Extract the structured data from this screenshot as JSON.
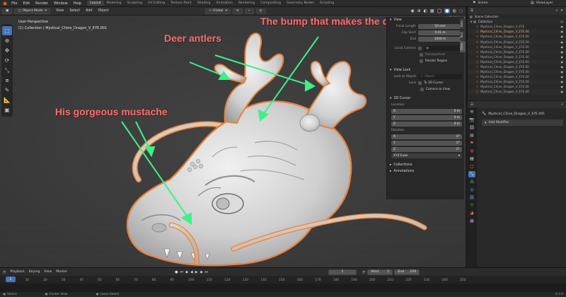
{
  "menu": [
    "File",
    "Edit",
    "Render",
    "Window",
    "Help"
  ],
  "workspaces": [
    "Layout",
    "Modeling",
    "Sculpting",
    "UV Editing",
    "Texture Paint",
    "Shading",
    "Animation",
    "Rendering",
    "Compositing",
    "Geometry Nodes",
    "Scripting"
  ],
  "scene_name": "Scene",
  "view_layer": "ViewLayer",
  "viewport_header": {
    "mode": "Object Mode",
    "menus": [
      "View",
      "Select",
      "Add",
      "Object"
    ],
    "orientation": "Global"
  },
  "viewport_info": {
    "line1": "User Perspective",
    "line2": "(1) Collection | Mystical_Chine_Dragon_V_EYE.001"
  },
  "options_label": "Options",
  "annotations": {
    "dragon_fly": "The bump that makes the dragon fly",
    "antlers": "Deer antlers",
    "mustache": "His gorgeous mustache",
    "color": "#ff6b6b",
    "arrow_color": "#3df08a"
  },
  "npanel": {
    "view_header": "View",
    "focal_length_label": "Focal Length",
    "focal_length": "50 mm",
    "clip_start_label": "Clip Start",
    "clip_start": "0.01 m",
    "clip_end_label": "End",
    "clip_end": "1000 m",
    "local_camera_label": "Local Camera",
    "passepartout_label": "Passepartout",
    "render_region_label": "Render Region",
    "view_lock_header": "View Lock",
    "lock_object_label": "Lock to Object",
    "lock_object_placeholder": "Object",
    "lock_label": "Lock",
    "to_3d_cursor": "To 3D Cursor",
    "camera_to_view": "Camera to View",
    "cursor_header": "3D Cursor",
    "location_label": "Location:",
    "loc_x_label": "X",
    "loc_x": "0 m",
    "loc_y_label": "Y",
    "loc_y": "0 m",
    "loc_z_label": "Z",
    "loc_z": "0 m",
    "rotation_label": "Rotation:",
    "rot_x_label": "X",
    "rot_x": "0°",
    "rot_y_label": "Y",
    "rot_y": "0°",
    "rot_z_label": "Z",
    "rot_z": "0°",
    "rotation_mode": "XYZ Euler",
    "collections_header": "Collections",
    "annotations_header": "Annotations",
    "tabs": [
      "Item",
      "Tool",
      "View"
    ]
  },
  "outliner": {
    "scene_collection": "Scene Collection",
    "collection": "Collection",
    "items": [
      "Mystical_Chine_Dragon_V_EYE",
      "Mystical_Chine_Dragon_V_EYE.00",
      "Mystical_Chine_Dragon_V_EYE.00",
      "Mystical_Chine_Dragon_V_EYE.00",
      "Mystical_Chine_Dragon_V_EYE.00",
      "Mystical_Chine_Dragon_V_EYE.00",
      "Mystical_Chine_Dragon_V_EYE.00",
      "Mystical_Chine_Dragon_V_EYE.00",
      "Mystical_Chine_Dragon_V_EYE.00",
      "Mystical_Chine_Dragon_V_EYE.00",
      "Mystical_Chine_Dragon_V_EYE.00",
      "Mystical_Chine_Dragon_V_EYE.00",
      "Mystical_Chine_Dragon_V_EYE.00",
      "Mystical_Chine_Dragon_V_EYE.00"
    ]
  },
  "properties": {
    "object_name": "Mystical_Chine_Dragon_V_EYE.001",
    "add_modifier": "Add Modifier"
  },
  "timeline": {
    "menus": [
      "Playback",
      "Keying",
      "View",
      "Marker"
    ],
    "current_frame": "1",
    "start_label": "Start",
    "start": "1",
    "end_label": "End",
    "end": "250",
    "ticks": [
      "1",
      "10",
      "20",
      "30",
      "40",
      "50",
      "60",
      "70",
      "80",
      "90",
      "100",
      "110",
      "120",
      "130",
      "140",
      "150",
      "160",
      "170",
      "180",
      "190",
      "200",
      "210",
      "220",
      "230",
      "240",
      "250"
    ]
  },
  "status": {
    "left": "Select",
    "middle": "Center View",
    "right": "Lasso Select",
    "version": "4.3.0"
  }
}
